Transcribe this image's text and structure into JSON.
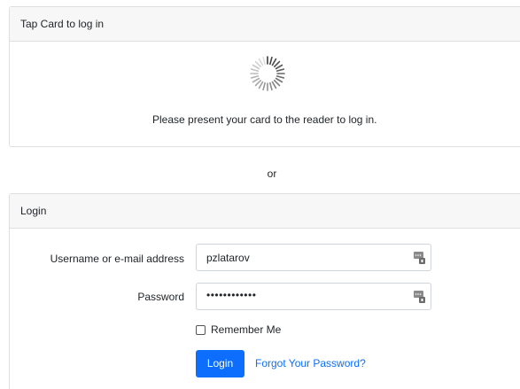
{
  "tap_card": {
    "header": "Tap Card to log in",
    "message": "Please present your card to the reader to log in."
  },
  "separator": {
    "text": "or"
  },
  "login_card": {
    "header": "Login",
    "username": {
      "label": "Username or e-mail address",
      "value": "pzlatarov",
      "icon": "password-manager-key-icon"
    },
    "password": {
      "label": "Password",
      "value": "••••••••••••",
      "icon": "password-manager-key-icon"
    },
    "remember_me": {
      "label": "Remember Me",
      "checked": false
    },
    "login_button": "Login",
    "forgot_link": "Forgot Your Password?"
  },
  "colors": {
    "primary": "#0d6efd",
    "header_bg": "#f7f7f7",
    "border": "#dfdfdf"
  }
}
